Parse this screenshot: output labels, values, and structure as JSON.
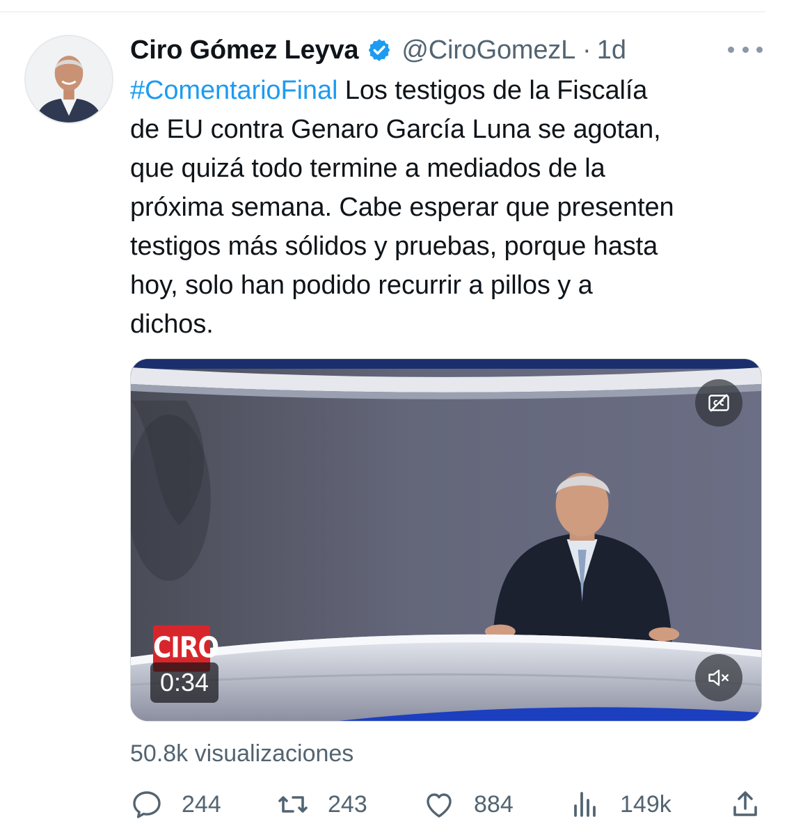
{
  "tweet": {
    "display_name": "Ciro Gómez Leyva",
    "handle": "@CiroGomezL",
    "separator": "·",
    "time": "1d",
    "hashtag": "#ComentarioFinal",
    "body_lines": [
      " Los testigos de la Fiscalía",
      "de EU contra Genaro García Luna se agotan,",
      "que quizá todo termine a mediados de la",
      "próxima semana. Cabe esperar que presenten",
      "testigos más sólidos y pruebas, porque hasta",
      "hoy, solo han podido recurrir a pillos y a",
      "dichos."
    ],
    "icons": {
      "verified": "verified-badge-icon",
      "more": "more-options-icon",
      "cc": "closed-captions-icon",
      "mute": "muted-speaker-icon",
      "reply": "reply-icon",
      "retweet": "retweet-icon",
      "like": "like-icon",
      "analytics": "analytics-icon",
      "share": "share-icon"
    },
    "colors": {
      "accent": "#1d9bf0",
      "text": "#0f1419",
      "secondary": "#536471"
    }
  },
  "media": {
    "logo_text": "CIRO",
    "duration": "0:34"
  },
  "stats": {
    "views_count": "50.8k",
    "views_label": "visualizaciones"
  },
  "actions": {
    "replies": "244",
    "retweets": "243",
    "likes": "884",
    "analytics": "149k"
  }
}
